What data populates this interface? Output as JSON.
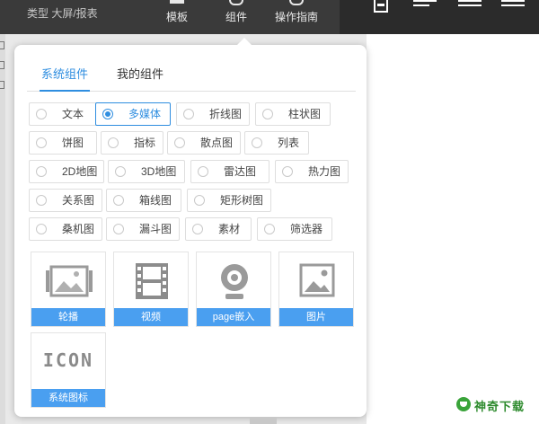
{
  "toolbar": {
    "type_label": "类型 大屏/报表",
    "template_label": "模板",
    "component_label": "组件",
    "guide_label": "操作指南"
  },
  "tabs": {
    "system": "系统组件",
    "mine": "我的组件"
  },
  "components": [
    {
      "label": "文本",
      "selected": false
    },
    {
      "label": "多媒体",
      "selected": true
    },
    {
      "label": "折线图",
      "selected": false
    },
    {
      "label": "柱状图",
      "selected": false
    },
    {
      "label": "饼图",
      "selected": false
    },
    {
      "label": "指标",
      "selected": false
    },
    {
      "label": "散点图",
      "selected": false
    },
    {
      "label": "列表",
      "selected": false
    },
    {
      "label": "2D地图",
      "selected": false
    },
    {
      "label": "3D地图",
      "selected": false
    },
    {
      "label": "雷达图",
      "selected": false
    },
    {
      "label": "热力图",
      "selected": false
    },
    {
      "label": "关系图",
      "selected": false
    },
    {
      "label": "箱线图",
      "selected": false
    },
    {
      "label": "矩形树图",
      "selected": false
    },
    {
      "label": "桑机图",
      "selected": false
    },
    {
      "label": "漏斗图",
      "selected": false
    },
    {
      "label": "素材",
      "selected": false
    },
    {
      "label": "筛选器",
      "selected": false
    }
  ],
  "media": [
    {
      "label": "轮播",
      "icon": "carousel-icon"
    },
    {
      "label": "视频",
      "icon": "film-icon"
    },
    {
      "label": "page嵌入",
      "icon": "webcam-icon"
    },
    {
      "label": "图片",
      "icon": "picture-icon"
    },
    {
      "label": "系统图标",
      "icon": "icon-text-icon",
      "icon_text": "ICON"
    }
  ],
  "watermark": "神奇下载",
  "colors": {
    "accent": "#2f8ee0",
    "card_caption": "#4a9ff0",
    "toolbar": "#3a3a3a",
    "watermark": "#2e8b2e"
  }
}
